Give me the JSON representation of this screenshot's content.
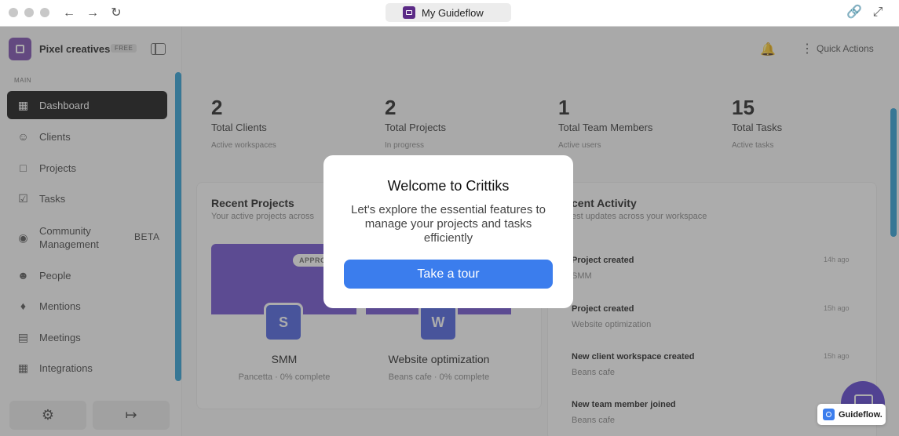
{
  "browser": {
    "tab_title": "My Guideflow",
    "tab_icon": "guideflow-logo-icon"
  },
  "workspace": {
    "name": "Pixel creatives",
    "plan_badge": "FREE"
  },
  "sidebar": {
    "section_label": "MAIN",
    "items": [
      {
        "label": "Dashboard",
        "icon": "dashboard-icon",
        "active": true
      },
      {
        "label": "Clients",
        "icon": "users-icon"
      },
      {
        "label": "Projects",
        "icon": "folder-icon"
      },
      {
        "label": "Tasks",
        "icon": "checkbox-icon"
      },
      {
        "label": "Community Management",
        "icon": "community-icon",
        "badge": "BETA"
      },
      {
        "label": "People",
        "icon": "people-icon"
      },
      {
        "label": "Mentions",
        "icon": "bell-icon"
      },
      {
        "label": "Meetings",
        "icon": "calendar-icon"
      },
      {
        "label": "Integrations",
        "icon": "grid-icon"
      }
    ]
  },
  "topbar": {
    "quick_actions_label": "Quick Actions"
  },
  "stats": [
    {
      "value": "2",
      "label": "Total Clients",
      "sub": "Active workspaces"
    },
    {
      "value": "2",
      "label": "Total Projects",
      "sub": "In progress"
    },
    {
      "value": "1",
      "label": "Total Team Members",
      "sub": "Active users"
    },
    {
      "value": "15",
      "label": "Total Tasks",
      "sub": "Active tasks"
    }
  ],
  "recent_projects": {
    "title": "Recent Projects",
    "subtitle": "Your active projects across",
    "status_badge": "APPRO",
    "projects": [
      {
        "initial": "S",
        "name": "SMM",
        "meta": "Pancetta · 0% complete"
      },
      {
        "initial": "W",
        "name": "Website optimization",
        "meta": "Beans cafe · 0% complete"
      }
    ]
  },
  "recent_activity": {
    "title": "cent Activity",
    "subtitle": "est updates across your workspace",
    "items": [
      {
        "title": "Project created",
        "sub": "SMM",
        "time": "14h ago"
      },
      {
        "title": "Project created",
        "sub": "Website optimization",
        "time": "15h ago"
      },
      {
        "title": "New client workspace created",
        "sub": "Beans cafe",
        "time": "15h ago"
      },
      {
        "title": "New team member joined",
        "sub": "Beans cafe",
        "time": ""
      }
    ]
  },
  "modal": {
    "title": "Welcome to Crittiks",
    "description": "Let's explore the essential features to manage your projects and tasks efficiently",
    "button_label": "Take a tour"
  },
  "badge": {
    "label": "Guideflow."
  }
}
